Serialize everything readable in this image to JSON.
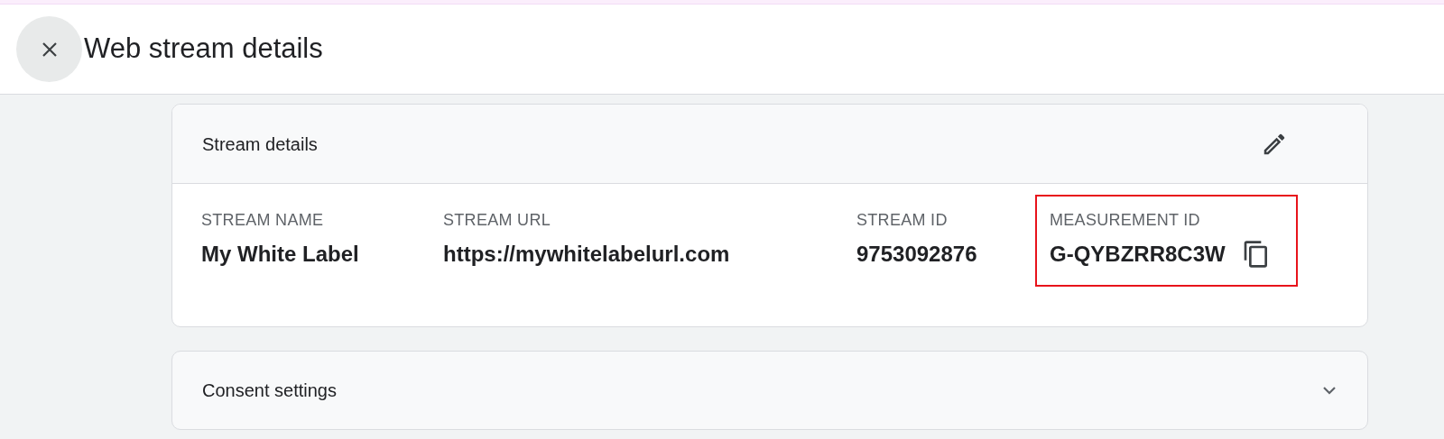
{
  "header": {
    "title": "Web stream details"
  },
  "stream_details": {
    "title": "Stream details",
    "fields": [
      {
        "label": "STREAM NAME",
        "value": "My White Label",
        "highlighted": false,
        "copyable": false
      },
      {
        "label": "STREAM URL",
        "value": "https://mywhitelabelurl.com",
        "highlighted": false,
        "copyable": false
      },
      {
        "label": "STREAM ID",
        "value": "9753092876",
        "highlighted": false,
        "copyable": false
      },
      {
        "label": "MEASUREMENT ID",
        "value": "G-QYBZRR8C3W",
        "highlighted": true,
        "copyable": true
      }
    ]
  },
  "consent_settings": {
    "title": "Consent settings",
    "expanded": false
  }
}
